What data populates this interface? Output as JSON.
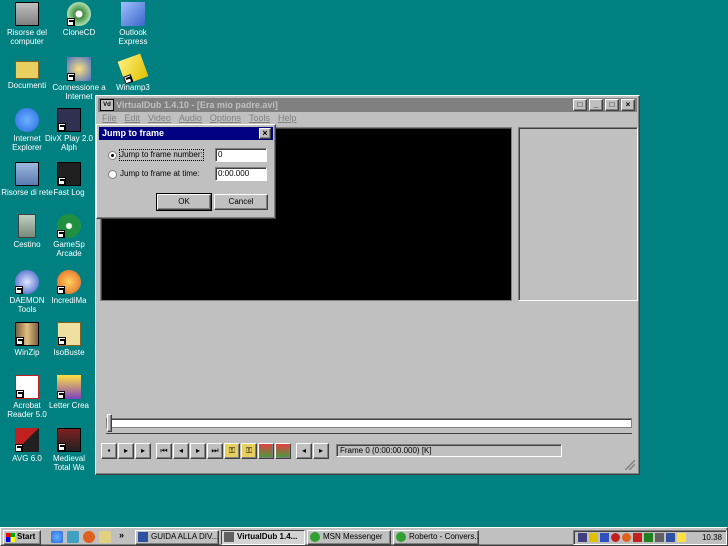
{
  "desktop": {
    "icons": [
      {
        "name": "risorse-computer",
        "label": "Risorse del computer",
        "color": "#4a6aa8"
      },
      {
        "name": "clonecd",
        "label": "CloneCD",
        "color": "#3a8a3a"
      },
      {
        "name": "outlook-express",
        "label": "Outlook Express",
        "color": "#3a66c8"
      },
      {
        "name": "documenti",
        "label": "Documenti",
        "color": "#e8d060"
      },
      {
        "name": "connessione-internet",
        "label": "Connessione a Internet",
        "color": "#4a70c0"
      },
      {
        "name": "winamp3",
        "label": "Winamp3",
        "color": "#e0c000"
      },
      {
        "name": "internet-explorer",
        "label": "Internet Explorer",
        "color": "#2a6ae0"
      },
      {
        "name": "divx-player",
        "label": "DivX Play 2.0 Alph",
        "color": "#303050"
      },
      {
        "name": "risorse-rete",
        "label": "Risorse di rete",
        "color": "#5a7ab0"
      },
      {
        "name": "fast-logo",
        "label": "Fast Log",
        "color": "#202020"
      },
      {
        "name": "cestino",
        "label": "Cestino",
        "color": "#7a8a7a"
      },
      {
        "name": "gamespy-arcade",
        "label": "GameSp Arcade",
        "color": "#209040"
      },
      {
        "name": "daemon-tools",
        "label": "DAEMON Tools",
        "color": "#3050c0"
      },
      {
        "name": "incredimail",
        "label": "IncrediMa",
        "color": "#e06020"
      },
      {
        "name": "winzip",
        "label": "WinZip",
        "color": "#806040"
      },
      {
        "name": "isobuster",
        "label": "IsoBuste",
        "color": "#c0a040"
      },
      {
        "name": "acrobat-reader",
        "label": "Acrobat Reader 5.0",
        "color": "#c02020"
      },
      {
        "name": "letter-creator",
        "label": "Letter Crea",
        "color": "#8040c0"
      },
      {
        "name": "avg",
        "label": "AVG 6.0",
        "color": "#c02020"
      },
      {
        "name": "medieval-total-war",
        "label": "Medieval Total Wa",
        "color": "#802020"
      }
    ]
  },
  "virtualdub": {
    "title": "VirtualDub 1.4.10 - [Era mio padre.avi]",
    "app_icon": "Vd",
    "menu": [
      "File",
      "Edit",
      "Video",
      "Audio",
      "Options",
      "Tools",
      "Help"
    ],
    "title_buttons": [
      "□",
      "_",
      "□",
      "×"
    ],
    "toolbar": [
      "stop",
      "play-input",
      "play-output",
      "start",
      "back",
      "forward",
      "end",
      "prev-key",
      "next-key",
      "scene-rev",
      "scene-fwd",
      "mark-in",
      "mark-out"
    ],
    "status": "Frame 0 (0:00:00.000) [K]",
    "position": 0
  },
  "dialog": {
    "title": "Jump to frame",
    "close_glyph": "×",
    "option_frame": "Jump to frame number:",
    "option_time": "Jump to frame at time:",
    "frame_value": "0",
    "time_value": "0:00.000",
    "ok": "OK",
    "cancel": "Cancel",
    "selected": "frame"
  },
  "taskbar": {
    "start": "Start",
    "chevron": "»",
    "tasks": [
      {
        "label": "GUIDA ALLA DIV...",
        "color": "#3050a0"
      },
      {
        "label": "VirtualDub 1.4...",
        "color": "#606060"
      },
      {
        "label": "MSN Messenger",
        "color": "#30a030"
      },
      {
        "label": "Roberto - Convers...",
        "color": "#30a030"
      }
    ],
    "clock": "10.38"
  }
}
